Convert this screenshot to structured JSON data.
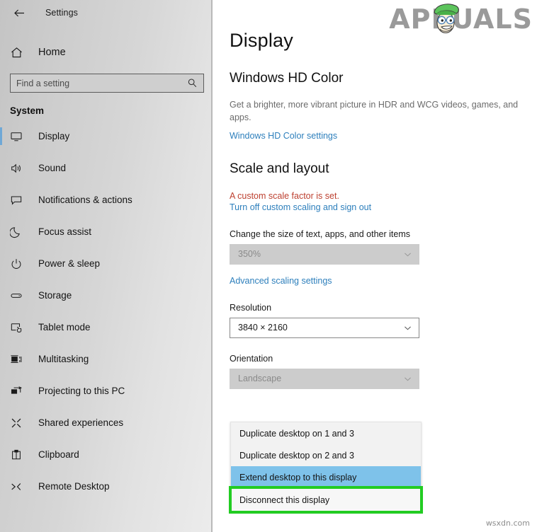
{
  "window": {
    "app_title": "Settings",
    "back_icon": "back-arrow-icon"
  },
  "sidebar": {
    "home_label": "Home",
    "home_icon": "home-icon",
    "search": {
      "placeholder": "Find a setting",
      "value": "",
      "icon": "search-icon"
    },
    "group_title": "System",
    "items": [
      {
        "label": "Display",
        "icon": "monitor-icon",
        "selected": true
      },
      {
        "label": "Sound",
        "icon": "speaker-icon",
        "selected": false
      },
      {
        "label": "Notifications & actions",
        "icon": "notification-icon",
        "selected": false
      },
      {
        "label": "Focus assist",
        "icon": "moon-icon",
        "selected": false
      },
      {
        "label": "Power & sleep",
        "icon": "power-icon",
        "selected": false
      },
      {
        "label": "Storage",
        "icon": "storage-icon",
        "selected": false
      },
      {
        "label": "Tablet mode",
        "icon": "tablet-icon",
        "selected": false
      },
      {
        "label": "Multitasking",
        "icon": "multitasking-icon",
        "selected": false
      },
      {
        "label": "Projecting to this PC",
        "icon": "project-screen-icon",
        "selected": false
      },
      {
        "label": "Shared experiences",
        "icon": "share-icon",
        "selected": false
      },
      {
        "label": "Clipboard",
        "icon": "clipboard-icon",
        "selected": false
      },
      {
        "label": "Remote Desktop",
        "icon": "remote-desktop-icon",
        "selected": false
      }
    ]
  },
  "main": {
    "page_title": "Display",
    "hd_color": {
      "heading": "Windows HD Color",
      "description": "Get a brighter, more vibrant picture in HDR and WCG videos, games, and apps.",
      "link": "Windows HD Color settings"
    },
    "scale_layout": {
      "heading": "Scale and layout",
      "warning": "A custom scale factor is set.",
      "turn_off_link": "Turn off custom scaling and sign out",
      "scale_label": "Change the size of text, apps, and other items",
      "scale_value": "350%",
      "advanced_link": "Advanced scaling settings",
      "resolution_label": "Resolution",
      "resolution_value": "3840 × 2160",
      "orientation_label": "Orientation",
      "orientation_value": "Landscape"
    },
    "multiple_displays_dropdown": {
      "options": [
        {
          "label": "Duplicate desktop on 1 and 3",
          "state": "normal"
        },
        {
          "label": "Duplicate desktop on 2 and 3",
          "state": "normal"
        },
        {
          "label": "Extend desktop to this display",
          "state": "highlighted"
        },
        {
          "label": "Disconnect this display",
          "state": "annotated"
        }
      ]
    }
  },
  "branding": {
    "logo_text": "APPUALS",
    "watermark": "wsxdn.com"
  },
  "colors": {
    "link_blue": "#2d7fbc",
    "warning_red": "#bd4030",
    "highlight_blue": "#7ec2ea",
    "annotation_green": "#22cc22",
    "selection_bar": "#6fa8d6",
    "logo_gray": "#9a9a9a"
  }
}
